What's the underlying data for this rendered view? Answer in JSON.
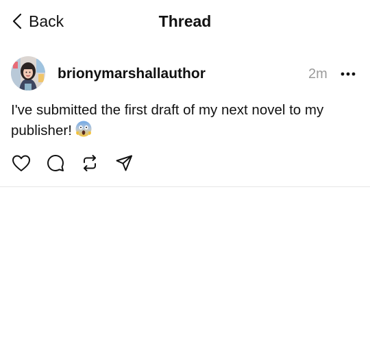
{
  "header": {
    "back_label": "Back",
    "title": "Thread"
  },
  "post": {
    "username": "brionymarshallauthor",
    "time": "2m",
    "text": "I've submitted the first draft of my next novel to my publisher!",
    "emoji": "face-screaming-in-fear",
    "avatar": "author-profile-photo"
  },
  "actions": [
    "heart-icon",
    "comment-icon",
    "repost-icon",
    "share-icon"
  ],
  "icons": {
    "back": "chevron-left-icon",
    "more": "more-dots-icon"
  }
}
